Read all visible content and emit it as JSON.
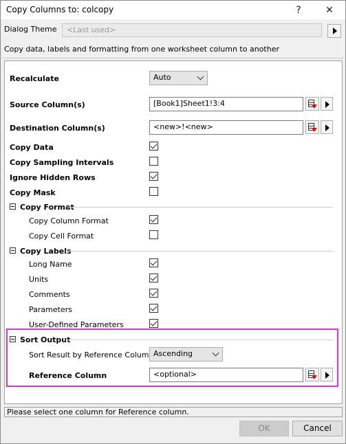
{
  "window": {
    "title": "Copy Columns to: colcopy",
    "help_label": "?",
    "close_label": "✕"
  },
  "theme": {
    "label": "Dialog Theme",
    "value": "<Last used>"
  },
  "description": "Copy data, labels and formatting from one worksheet column to another",
  "form": {
    "recalculate": {
      "label": "Recalculate",
      "value": "Auto"
    },
    "source": {
      "label": "Source Column(s)",
      "value": "[Book1]Sheet1!3:4"
    },
    "destination": {
      "label": "Destination Column(s)",
      "value": "<new>!<new>"
    },
    "copy_data": {
      "label": "Copy Data",
      "checked": true
    },
    "copy_sampling": {
      "label": "Copy Sampling Intervals",
      "checked": false
    },
    "ignore_hidden": {
      "label": "Ignore Hidden Rows",
      "checked": true
    },
    "copy_mask": {
      "label": "Copy Mask",
      "checked": false
    },
    "copy_format": {
      "label": "Copy Format",
      "column_format": {
        "label": "Copy Column Format",
        "checked": true
      },
      "cell_format": {
        "label": "Copy Cell Format",
        "checked": false
      }
    },
    "copy_labels": {
      "label": "Copy Labels",
      "long_name": {
        "label": "Long Name",
        "checked": true
      },
      "units": {
        "label": "Units",
        "checked": true
      },
      "comments": {
        "label": "Comments",
        "checked": true
      },
      "parameters": {
        "label": "Parameters",
        "checked": true
      },
      "user_params": {
        "label": "User-Defined Parameters",
        "checked": true
      }
    },
    "sort_output": {
      "label": "Sort Output",
      "sort_by": {
        "label": "Sort Result by Reference Column",
        "value": "Ascending"
      },
      "reference": {
        "label": "Reference Column",
        "value": "<optional>"
      }
    }
  },
  "status": "Please select one column for Reference column.",
  "buttons": {
    "ok": "OK",
    "cancel": "Cancel"
  }
}
